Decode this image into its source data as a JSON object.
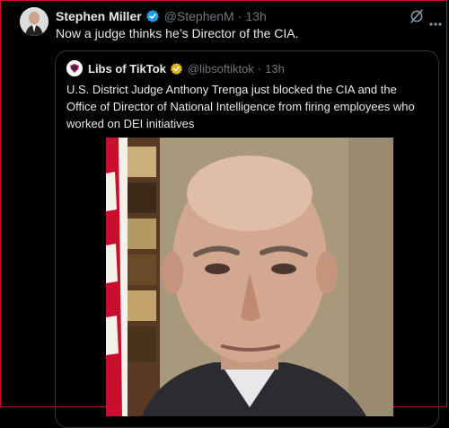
{
  "tweet": {
    "author_name": "Stephen Miller",
    "author_handle": "@StephenM",
    "separator": "·",
    "time": "13h",
    "text": "Now a judge thinks he’s Director of the CIA."
  },
  "quoted_tweet": {
    "author_name": "Libs of TikTok",
    "author_handle": "@libsoftiktok",
    "separator": "·",
    "time": "13h",
    "text": "U.S. District Judge Anthony Trenga just blocked the CIA and the Office of Director of National Intelligence from firing employees who worked on DEI initiatives"
  },
  "icons": {
    "verified": "verified-badge-icon",
    "grok": "grok-icon",
    "more": "more-icon"
  },
  "colors": {
    "background": "#000000",
    "text": "#e7e9ea",
    "muted": "#71767b",
    "verified_blue": "#1d9bf0",
    "verified_gold": "#e2b719",
    "border": "#2f3336"
  }
}
